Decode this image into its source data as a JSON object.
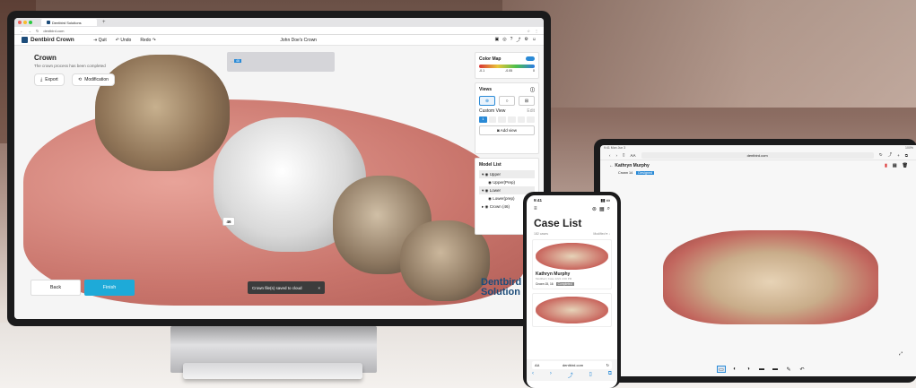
{
  "monitor": {
    "browser": {
      "tab_title": "Dentbird Solutions",
      "new_tab": "+",
      "url": "dentbird.com"
    },
    "app": {
      "logo": "Dentbird Crown",
      "quit": "Quit",
      "undo": "Undo",
      "redo": "Redo",
      "center_title": "John Doe's Crown"
    },
    "main": {
      "title": "Crown",
      "subtitle": "The crown process has been completed",
      "export": "Export",
      "modification": "Modification",
      "tooth_selected": "46",
      "tooth_badge": "46",
      "back": "Back",
      "finish": "Finish",
      "toast": "Crown file(s) saved to cloud",
      "toast_close": "×",
      "watermark_top": "Dentbird",
      "watermark_bottom": "Solution"
    },
    "color_map": {
      "title": "Color Map",
      "min": "-0.1",
      "mid": "-0.05",
      "max": "0"
    },
    "views": {
      "title": "Views",
      "custom_view": "Custom View",
      "edit": "Edit",
      "custom_first": "1",
      "add_view": "Add view"
    },
    "model_list": {
      "title": "Model List",
      "items": [
        "Upper",
        "Upper(Prep)",
        "Lower",
        "Lower(prep)",
        "Crown (46)"
      ]
    }
  },
  "tablet": {
    "status_left": "9:41 Mon Jun 3",
    "status_right": "100%",
    "aa": "AA",
    "url": "dentbird.com",
    "title": "Kathryn Murphy",
    "tag1": "Crown 14",
    "tag2": "Designed"
  },
  "phone": {
    "time": "9:41",
    "title": "Case List",
    "count": "182 cases",
    "sort": "Modified",
    "card1_name": "Kathryn Murphy",
    "card1_meta": "Modified | Case 1221 4:00 PM",
    "card1_tag": "Crown 15, 16",
    "card1_status": "Completed",
    "aa": "AA",
    "url": "dentbird.com"
  }
}
